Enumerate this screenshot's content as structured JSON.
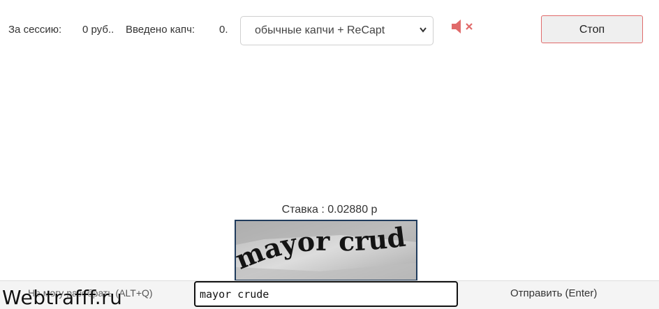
{
  "session": {
    "earned_label": "За сессию:",
    "earned_value": "0 руб..",
    "entered_label": "Введено капч:",
    "entered_value": "0."
  },
  "captcha_type": {
    "selected": "обычные капчи + ReCapt"
  },
  "controls": {
    "stop_label": "Стоп",
    "accent_color": "#e06a6a"
  },
  "task": {
    "rate": "Ставка : 0.02880 р",
    "captcha_text": "mayor crude"
  },
  "footer": {
    "hotkey_hint": "Не могу разобрать (ALT+Q)",
    "answer_value": "mayor crude",
    "send_label": "Отправить (Enter)",
    "watermark": "Webtrafff.ru"
  }
}
